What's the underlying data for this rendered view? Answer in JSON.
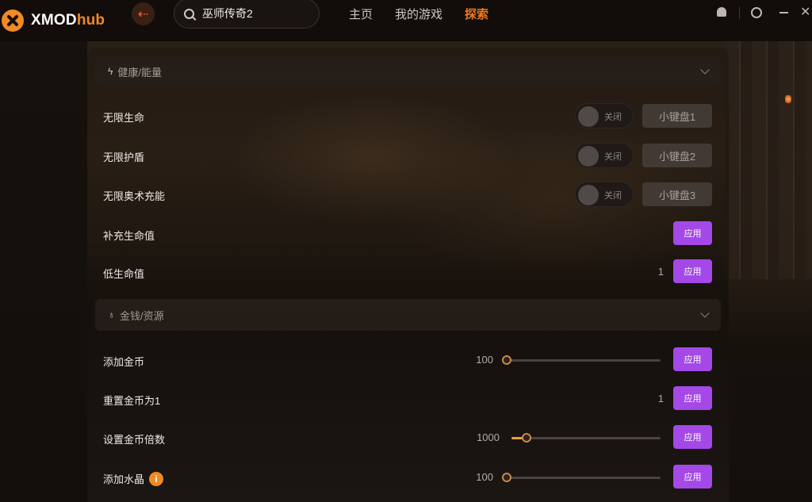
{
  "app": {
    "logo_text_main": "XMOD",
    "logo_text_accent": "hub",
    "accent_color": "#f08a24",
    "apply_button_color": "#a448e8"
  },
  "topbar": {
    "back_icon": "arrow-left-icon",
    "search_value": "巫师传奇2",
    "nav": [
      {
        "label": "主页",
        "active": false
      },
      {
        "label": "我的游戏",
        "active": false
      },
      {
        "label": "探索",
        "active": true
      }
    ],
    "window_icons": [
      "bell-icon",
      "settings-icon",
      "minimize-icon",
      "close-icon"
    ]
  },
  "sections": [
    {
      "title": "健康/能量",
      "icon": "lightning-icon",
      "rows": [
        {
          "label": "无限生命",
          "type": "toggle",
          "toggle_text": "关闭",
          "hotkey": "小键盘1"
        },
        {
          "label": "无限护盾",
          "type": "toggle",
          "toggle_text": "关闭",
          "hotkey": "小键盘2"
        },
        {
          "label": "无限奥术充能",
          "type": "toggle",
          "toggle_text": "关闭",
          "hotkey": "小键盘3"
        },
        {
          "label": "补充生命值",
          "type": "apply",
          "apply_label": "应用"
        },
        {
          "label": "低生命值",
          "type": "value-apply",
          "value": "1",
          "apply_label": "应用"
        }
      ]
    },
    {
      "title": "金钱/资源",
      "icon": "money-bag-icon",
      "rows": [
        {
          "label": "添加金币",
          "type": "slider",
          "value": "100",
          "fill": 0.0,
          "apply_label": "应用"
        },
        {
          "label": "重置金币为1",
          "type": "value-apply",
          "value": "1",
          "apply_label": "应用"
        },
        {
          "label": "设置金币倍数",
          "type": "slider",
          "value": "1000",
          "fill": 0.1,
          "apply_label": "应用"
        },
        {
          "label": "添加水晶",
          "type": "slider",
          "value": "100",
          "fill": 0.0,
          "apply_label": "应用",
          "info": "i"
        }
      ]
    }
  ]
}
